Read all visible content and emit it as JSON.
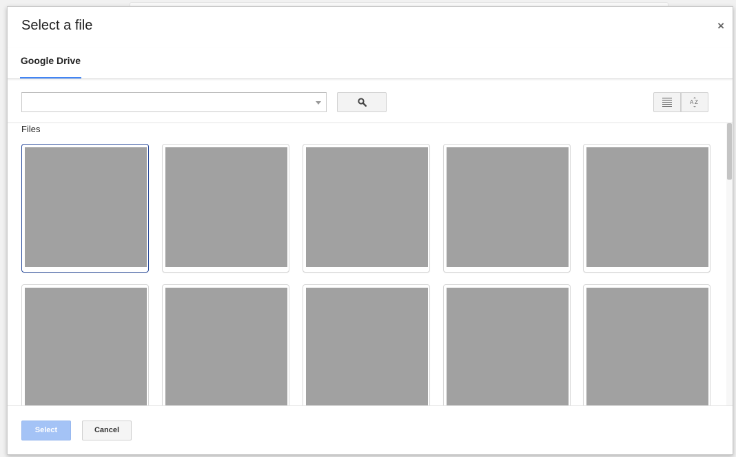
{
  "dialog": {
    "title": "Select a file",
    "close_glyph": "×",
    "tabs": [
      {
        "label": "Google Drive",
        "active": true
      }
    ]
  },
  "toolbar": {
    "search_value": "",
    "search_placeholder": "",
    "search_icon": "magnifier-icon",
    "list_view_icon": "list-view-icon",
    "sort_icon": "sort-az-icon"
  },
  "files": {
    "section_label": "Files",
    "items": [
      {
        "selected": true
      },
      {
        "selected": false
      },
      {
        "selected": false
      },
      {
        "selected": false
      },
      {
        "selected": false
      },
      {
        "selected": false
      },
      {
        "selected": false
      },
      {
        "selected": false
      },
      {
        "selected": false
      },
      {
        "selected": false
      }
    ]
  },
  "footer": {
    "select_label": "Select",
    "cancel_label": "Cancel"
  },
  "colors": {
    "accent": "#4285f4",
    "select_disabled": "#a4c3f6",
    "thumbnail": "#a1a1a1",
    "selected_border": "#2a4b9b"
  }
}
